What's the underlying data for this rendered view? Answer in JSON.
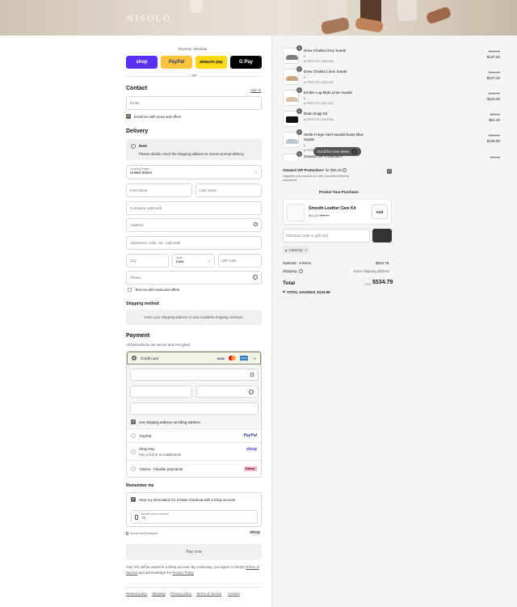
{
  "brand": {
    "logo": "NISOLO"
  },
  "express": {
    "label": "Express checkout",
    "or": "OR",
    "shop": "shop",
    "paypal": "PayPal",
    "amazon": "amazon pay",
    "gpay": "G Pay"
  },
  "contact": {
    "title": "Contact",
    "signin": "Sign in",
    "email_placeholder": "Email",
    "news_label": "Email me with news and offers"
  },
  "delivery": {
    "title": "Delivery",
    "note_title": "Note",
    "note_text": "Please double check the shipping address to ensure prompt delivery",
    "country_label": "Country/Region",
    "country_value": "United States",
    "first_name": "First name",
    "last_name": "Last name",
    "company": "Company (optional)",
    "address": "Address",
    "apartment": "Apartment, suite, etc. (optional)",
    "city": "City",
    "state_label": "State",
    "state_value": "Iowa",
    "zip": "ZIP code",
    "phone": "Phone",
    "sms_label": "Text me with news and offers"
  },
  "shipping_method": {
    "title": "Shipping method",
    "text": "Enter your shipping address to view available shipping methods."
  },
  "payment": {
    "title": "Payment",
    "subtitle": "All transactions are secure and encrypted.",
    "credit_card": "Credit card",
    "visa": "VISA",
    "amex": "AMEX",
    "more": "+5",
    "billing_label": "Use shipping address as billing address",
    "paypal": "PayPal",
    "paypal_logo": "PayPal",
    "shoppay": "Shop Pay",
    "shoppay_sub": "Pay in full or in installments",
    "shoppay_logo": "shop",
    "klarna": "Klarna - Flexible payments",
    "klarna_logo": "Klarna."
  },
  "remember": {
    "title": "Remember me",
    "save_label": "Save my information for a faster checkout with a Shop account",
    "mobile_label": "Mobile phone number",
    "mobile_value": "+1",
    "secure": "Secure and encrypted",
    "shop_logo": "shop"
  },
  "paynow": "Pay now",
  "legal": {
    "text1": "Your info will be saved to a Shop account. By continuing, you agree to Shop's",
    "terms": "Terms of Service",
    "and": "and acknowledge the",
    "privacy": "Privacy Policy"
  },
  "footer": [
    "Refund policy",
    "Shipping",
    "Privacy policy",
    "Terms of service",
    "Contact"
  ],
  "cart": {
    "items": [
      {
        "name": "Drew Chukka Grey Suede",
        "variant": "6",
        "discount": "FIRST20 (-$31.80)",
        "old": "$159.00",
        "price": "$127.20",
        "qty": "1"
      },
      {
        "name": "Drew Chukka Linen Suede",
        "variant": "6",
        "discount": "FIRST20 (-$31.80)",
        "old": "$159.00",
        "price": "$127.20",
        "qty": "1"
      },
      {
        "name": "Emilee Lug Mule Linen Suede",
        "variant": "6",
        "discount": "FIRST20 (-$27.60)",
        "old": "$138.00",
        "price": "$110.40",
        "qty": "1"
      },
      {
        "name": "Dean Dopp Kit",
        "variant": "",
        "discount": "FIRST20 (-$13.60)",
        "old": "$68.00",
        "price": "$54.40",
        "qty": "1"
      },
      {
        "name": "Stella Fringe Heel Sandal Dusty Blue Suede",
        "variant": "6",
        "discount": "FIRST20 (-$26.70)",
        "old": "$133.50",
        "price": "$106.80",
        "qty": "1"
      },
      {
        "name": "Onward VIP Protection+",
        "variant": "",
        "discount": "",
        "old": "$16.46",
        "price": "",
        "qty": "1"
      }
    ],
    "scroll_hint": "Scroll for more items",
    "vip_title": "Onward VIP Protection+",
    "vip_price": "for $16.46",
    "vip_desc": "Upgrade your experience with expedited delivery assurance",
    "protect_title": "Protect Your Purchase:",
    "upsell_name": "Smooth Leather Care Kit",
    "upsell_price": "$24.00",
    "upsell_old": "$30.00",
    "upsell_add": "Add",
    "discount_placeholder": "Discount code or gift card",
    "applied_code": "FIRST20",
    "subtotal_label": "Subtotal · 6 items",
    "subtotal_value": "$534.79",
    "shipping_label": "Shipping",
    "shipping_value": "Enter shipping address",
    "total_label": "Total",
    "currency": "USD",
    "total_value": "$534.79",
    "savings_label": "TOTAL SAVINGS",
    "savings_value": "$133.69"
  },
  "colors": {
    "accent": "#6b6a5a",
    "shop": "#5a31f4",
    "paypal": "#ffc439",
    "amazon": "#ffd814"
  }
}
